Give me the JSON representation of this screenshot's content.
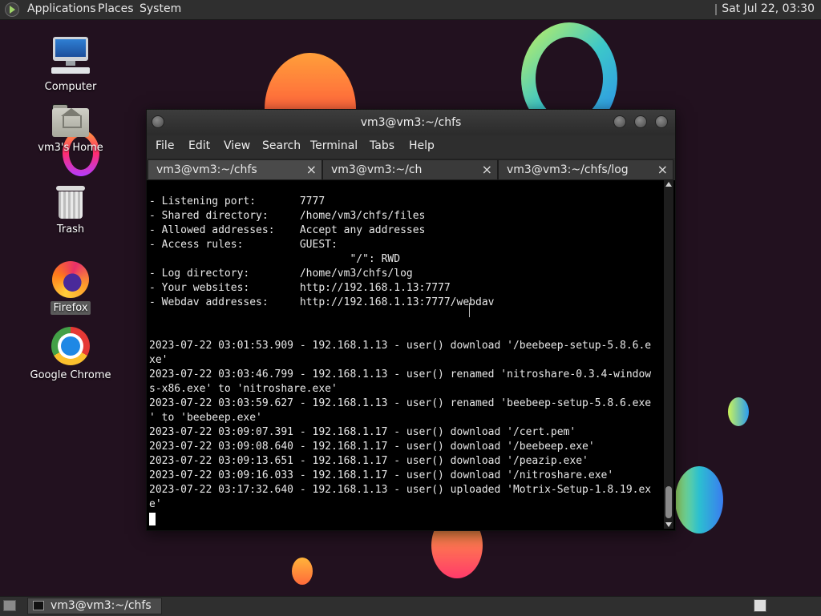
{
  "top_panel": {
    "menus": [
      "Applications",
      "Places",
      "System"
    ],
    "clock": "Sat Jul 22, 03:30"
  },
  "desktop_icons": [
    {
      "label": "Computer",
      "icon": "computer-icon"
    },
    {
      "label": "vm3's Home",
      "icon": "home-folder-icon"
    },
    {
      "label": "Trash",
      "icon": "trash-icon"
    },
    {
      "label": "Firefox",
      "icon": "firefox-icon",
      "selected": true
    },
    {
      "label": "Google Chrome",
      "icon": "chrome-icon"
    }
  ],
  "terminal": {
    "title": "vm3@vm3:~/chfs",
    "menu": [
      "File",
      "Edit",
      "View",
      "Search",
      "Terminal",
      "Tabs",
      "Help"
    ],
    "tabs": [
      {
        "label": "vm3@vm3:~/chfs",
        "active": true
      },
      {
        "label": "vm3@vm3:~/ch",
        "active": false
      },
      {
        "label": "vm3@vm3:~/chfs/log",
        "active": false
      }
    ],
    "lines": [
      "- Listening port:       7777",
      "- Shared directory:     /home/vm3/chfs/files",
      "- Allowed addresses:    Accept any addresses",
      "- Access rules:         GUEST:",
      "                                \"/\": RWD",
      "- Log directory:        /home/vm3/chfs/log",
      "- Your websites:        http://192.168.1.13:7777",
      "- Webdav addresses:     http://192.168.1.13:7777/webdav",
      "",
      "",
      "2023-07-22 03:01:53.909 - 192.168.1.13 - user() download '/beebeep-setup-5.8.6.e",
      "xe'",
      "2023-07-22 03:03:46.799 - 192.168.1.13 - user() renamed 'nitroshare-0.3.4-window",
      "s-x86.exe' to 'nitroshare.exe'",
      "2023-07-22 03:03:59.627 - 192.168.1.13 - user() renamed 'beebeep-setup-5.8.6.exe",
      "' to 'beebeep.exe'",
      "2023-07-22 03:09:07.391 - 192.168.1.17 - user() download '/cert.pem'",
      "2023-07-22 03:09:08.640 - 192.168.1.17 - user() download '/beebeep.exe'",
      "2023-07-22 03:09:13.651 - 192.168.1.17 - user() download '/peazip.exe'",
      "2023-07-22 03:09:16.033 - 192.168.1.17 - user() download '/nitroshare.exe'",
      "2023-07-22 03:17:32.640 - 192.168.1.13 - user() uploaded 'Motrix-Setup-1.8.19.ex",
      "e'"
    ]
  },
  "taskbar": {
    "window_button": "vm3@vm3:~/chfs"
  }
}
